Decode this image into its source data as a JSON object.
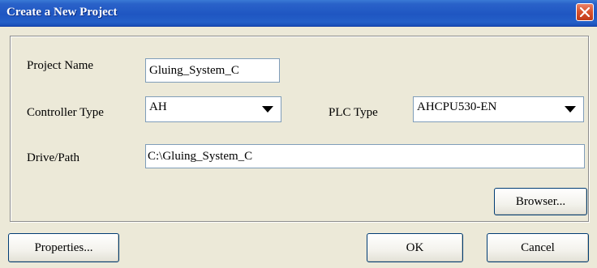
{
  "window": {
    "title": "Create a New Project"
  },
  "fields": {
    "project_name": {
      "label": "Project Name",
      "value": "Gluing_System_C"
    },
    "controller_type": {
      "label": "Controller Type",
      "value": "AH"
    },
    "plc_type": {
      "label": "PLC Type",
      "value": "AHCPU530-EN"
    },
    "drive_path": {
      "label": "Drive/Path",
      "value": "C:\\Gluing_System_C"
    }
  },
  "buttons": {
    "browser": "Browser...",
    "properties": "Properties...",
    "ok": "OK",
    "cancel": "Cancel"
  },
  "icons": {
    "close": "close-icon",
    "dropdown": "dropdown-arrow-icon"
  },
  "colors": {
    "titlebar": "#1f56c2",
    "dialog_bg": "#ece9d8",
    "close_button": "#d9542e"
  }
}
